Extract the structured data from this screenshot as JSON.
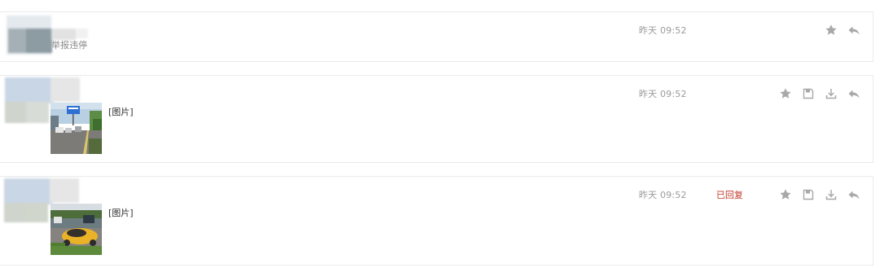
{
  "messages": [
    {
      "sub_text": "举报违停",
      "time": "昨天 09:52",
      "status": "",
      "icons": [
        "star-icon",
        "reply-icon"
      ]
    },
    {
      "image_label": "[图片]",
      "time": "昨天 09:52",
      "status": "",
      "icons": [
        "star-icon",
        "save-icon",
        "download-icon",
        "reply-icon"
      ]
    },
    {
      "image_label": "[图片]",
      "time": "昨天 09:52",
      "status": "已回复",
      "icons": [
        "star-icon",
        "save-icon",
        "download-icon",
        "reply-icon"
      ]
    }
  ],
  "colors": {
    "time": "#9a9a9a",
    "status_replied": "#c0392b",
    "icon": "#a8a8a8",
    "border": "#ebebeb"
  }
}
